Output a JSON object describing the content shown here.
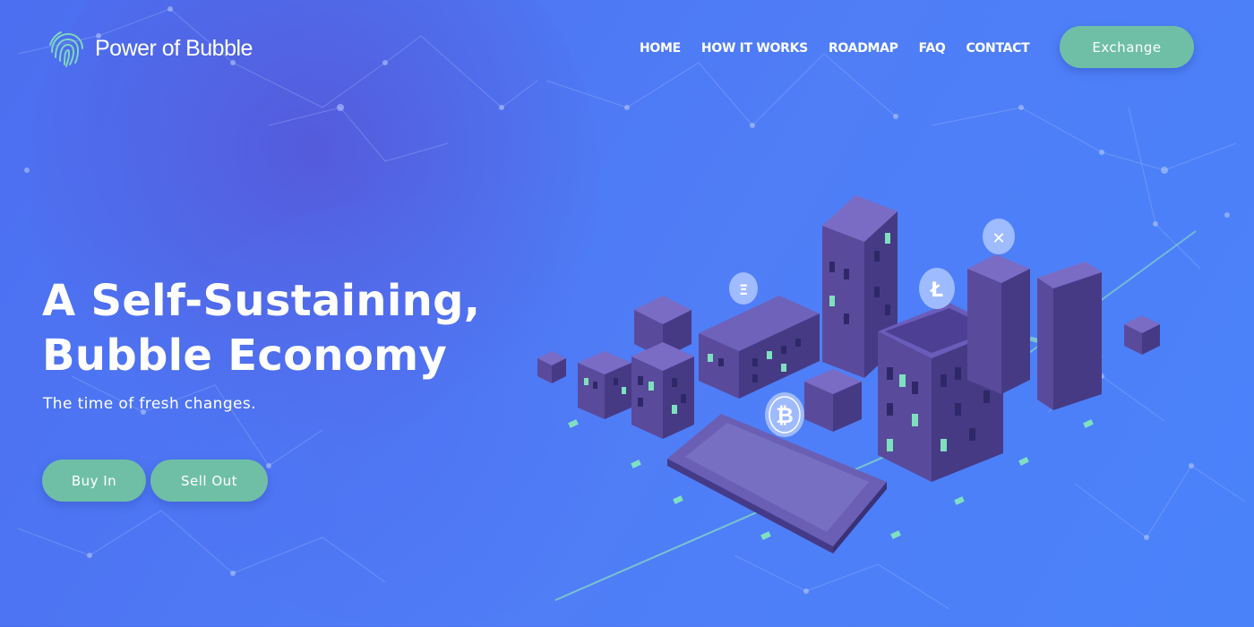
{
  "brand": {
    "name": "Power of Bubble",
    "logo_icon": "fingerprint-icon"
  },
  "nav": {
    "items": [
      "HOME",
      "HOW IT WORKS",
      "ROADMAP",
      "FAQ",
      "CONTACT"
    ],
    "exchange_label": "Exchange"
  },
  "hero": {
    "title_line1": "A Self-Sustaining,",
    "title_line2": "Bubble Economy",
    "subtitle": "The time of fresh changes.",
    "buy_label": "Buy In",
    "sell_label": "Sell Out"
  },
  "colors": {
    "accent": "#6fbfa6",
    "background": "#4f7ef7",
    "building": "#5a4a9c"
  }
}
